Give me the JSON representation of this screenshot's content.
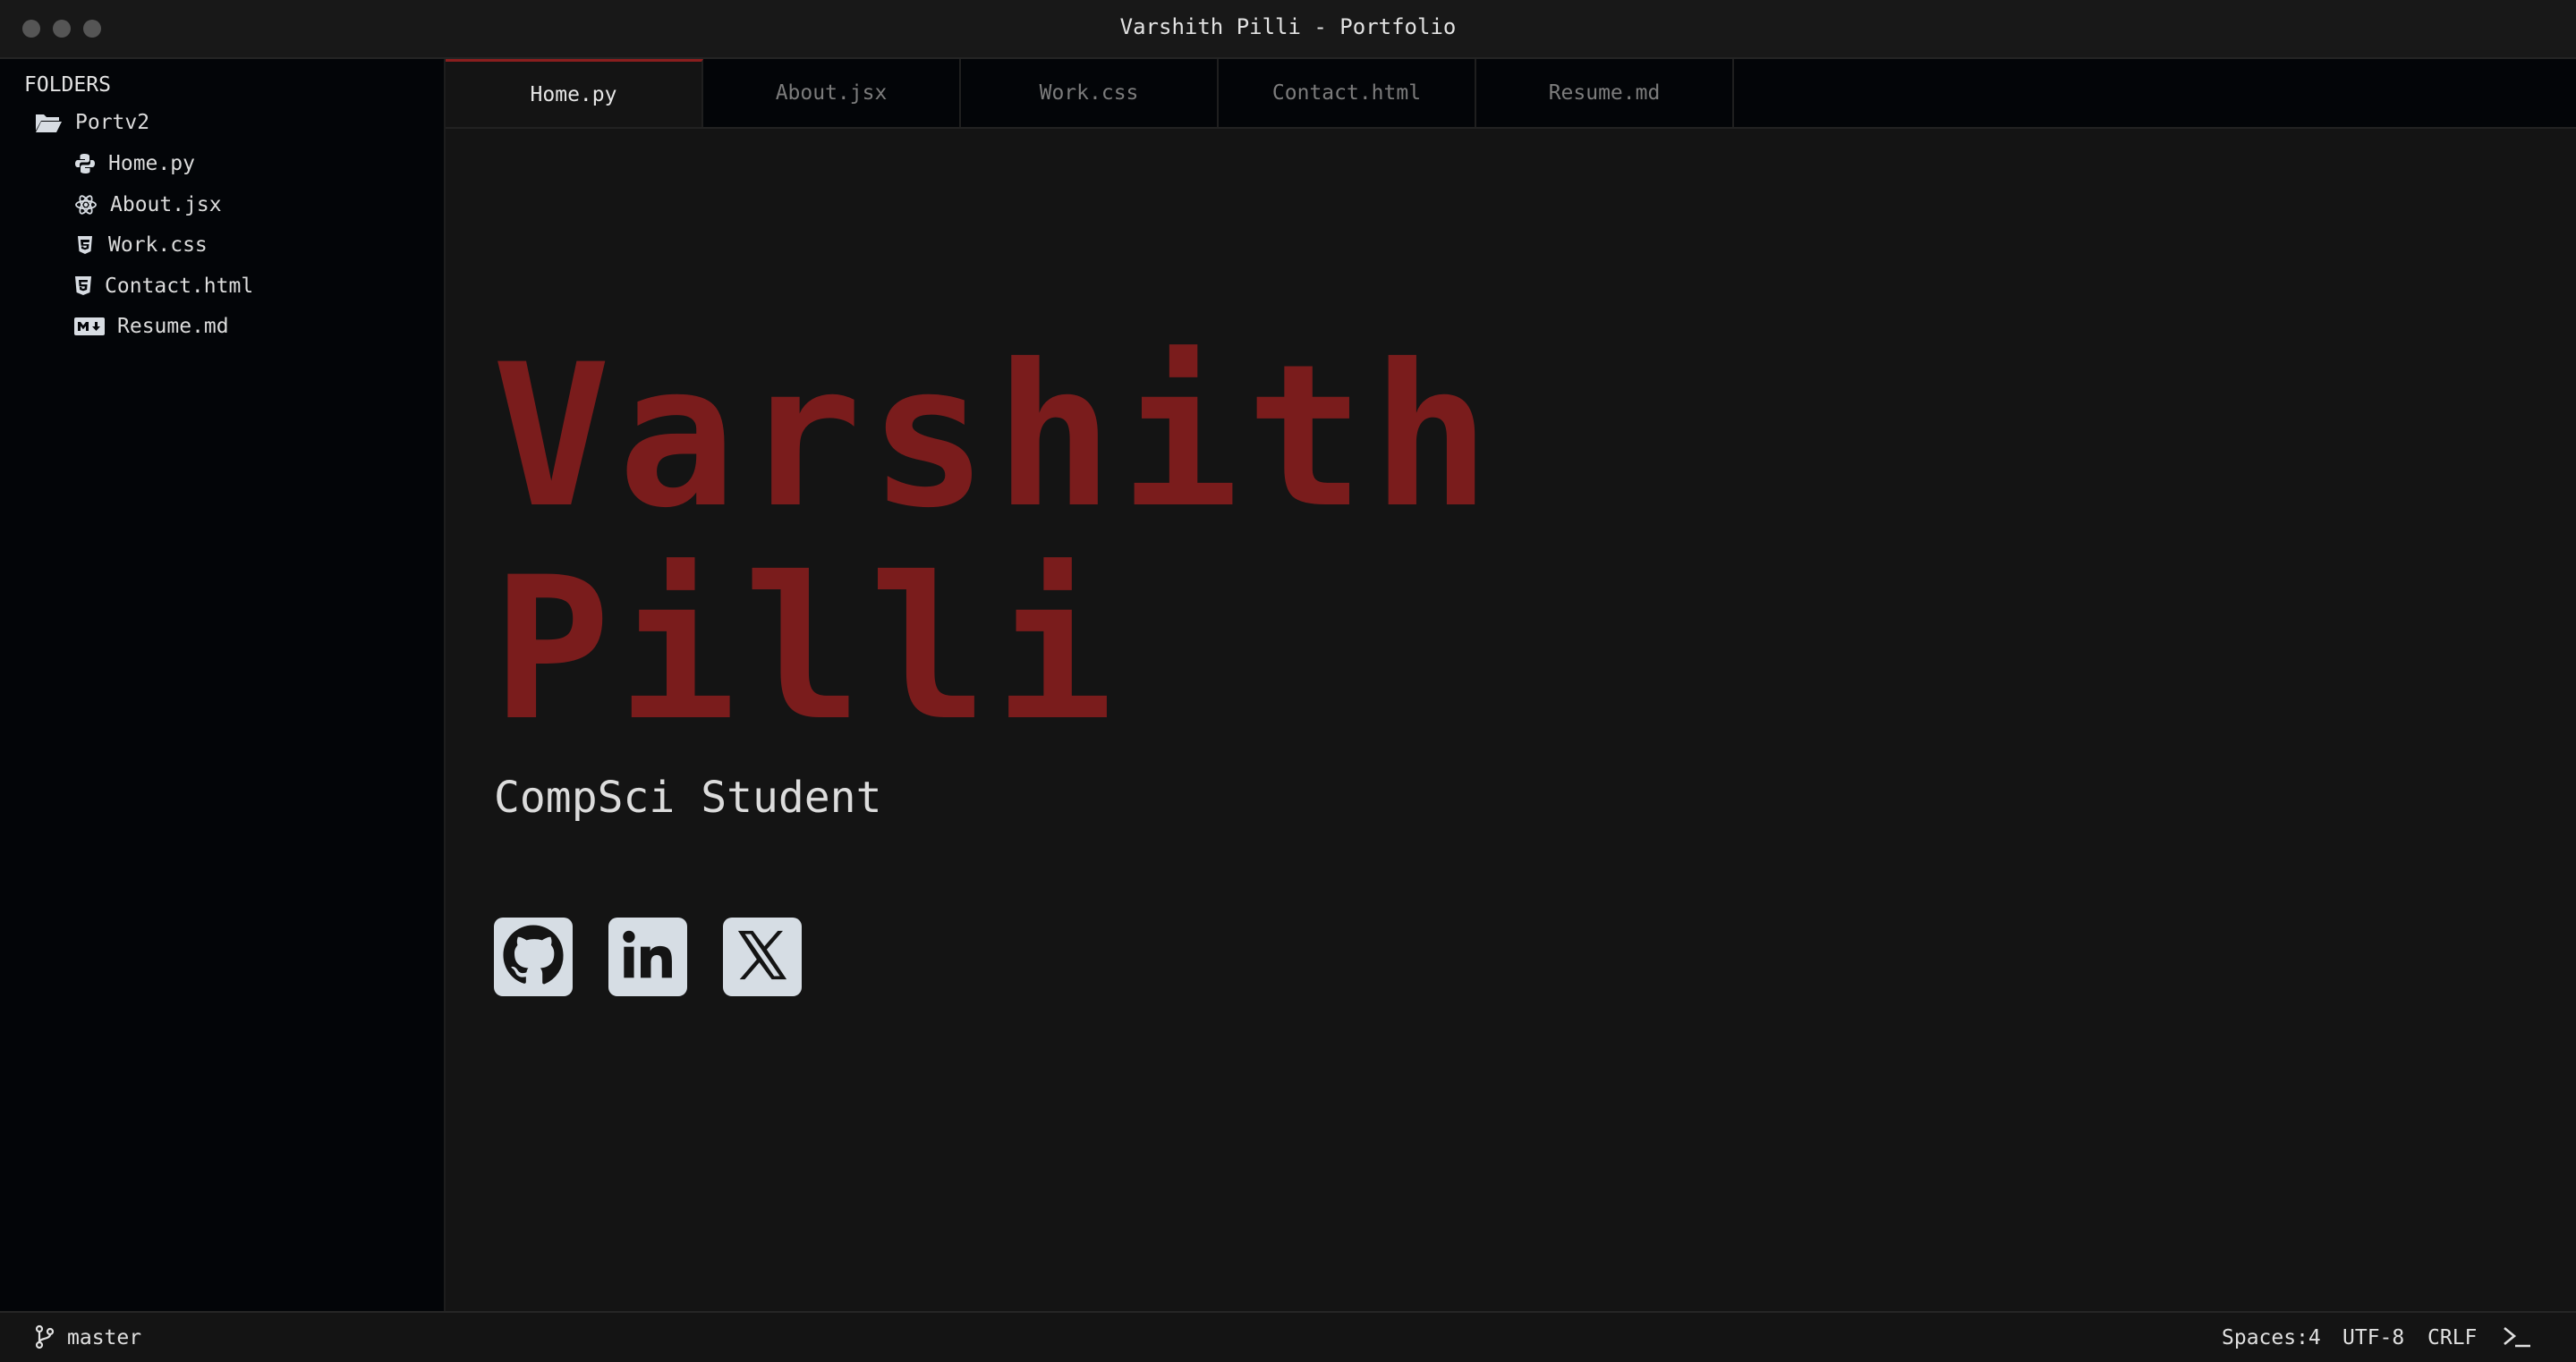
{
  "window": {
    "title": "Varshith Pilli - Portfolio"
  },
  "sidebar": {
    "heading": "FOLDERS",
    "folder": {
      "label": "Portv2",
      "icon": "folder-open-icon"
    },
    "files": [
      {
        "label": "Home.py",
        "icon": "python-icon"
      },
      {
        "label": "About.jsx",
        "icon": "react-icon"
      },
      {
        "label": "Work.css",
        "icon": "css3-icon"
      },
      {
        "label": "Contact.html",
        "icon": "html5-icon"
      },
      {
        "label": "Resume.md",
        "icon": "markdown-icon"
      }
    ]
  },
  "tabs": [
    {
      "label": "Home.py",
      "active": true
    },
    {
      "label": "About.jsx",
      "active": false
    },
    {
      "label": "Work.css",
      "active": false
    },
    {
      "label": "Contact.html",
      "active": false
    },
    {
      "label": "Resume.md",
      "active": false
    }
  ],
  "hero": {
    "first_name": "Varshith",
    "last_name": "Pilli",
    "subtitle": "CompSci Student",
    "name_color": "#7a1c1c"
  },
  "socials": [
    {
      "icon": "github-icon"
    },
    {
      "icon": "linkedin-icon"
    },
    {
      "icon": "x-twitter-icon"
    }
  ],
  "statusbar": {
    "branch": "master",
    "branch_icon": "git-branch-icon",
    "indent": "Spaces:4",
    "encoding": "UTF-8",
    "line_endings": "CRLF",
    "terminal_icon": "terminal-icon"
  },
  "colors": {
    "accent": "#8a1e1e",
    "background": "#141414",
    "sidebar_bg": "#030508"
  }
}
